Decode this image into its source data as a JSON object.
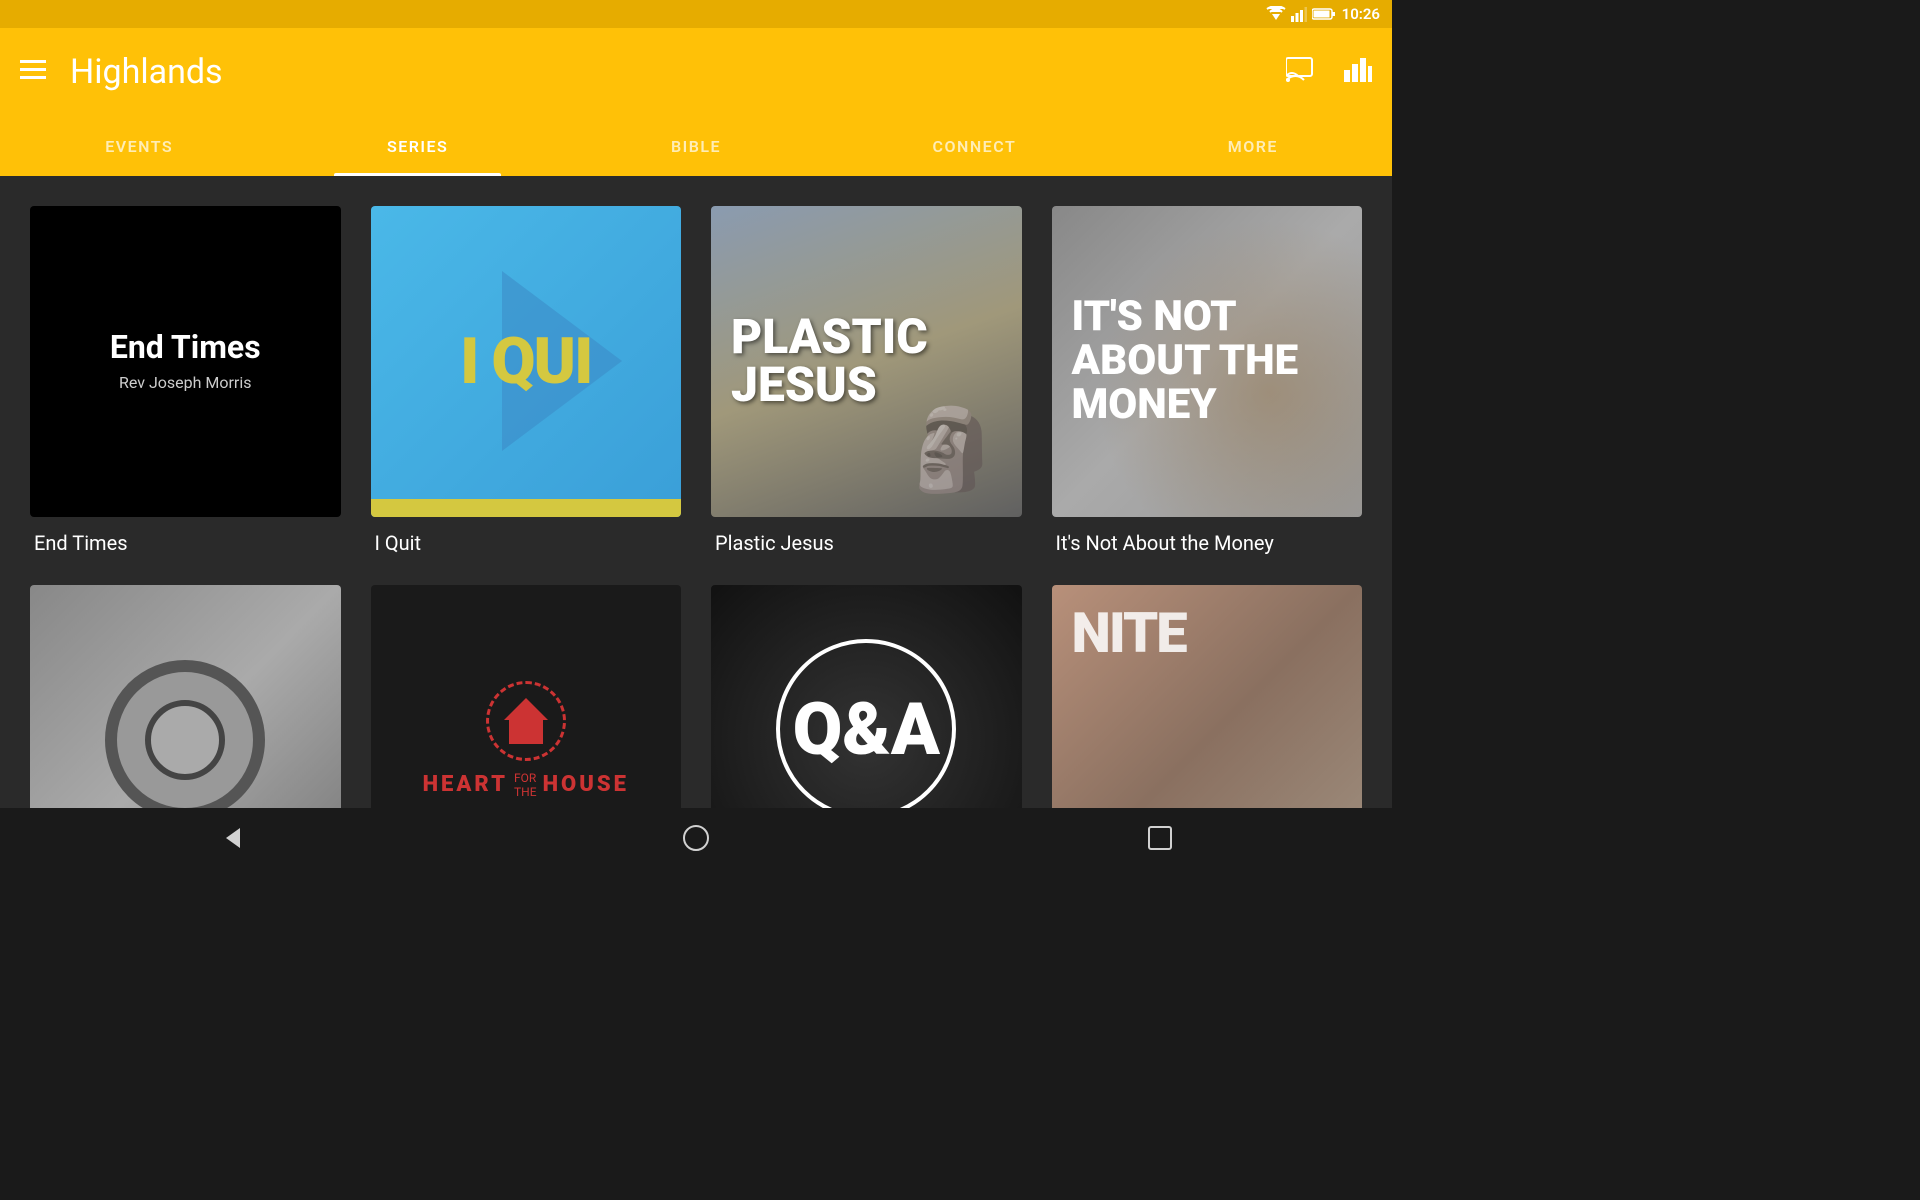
{
  "statusBar": {
    "time": "10:26"
  },
  "appBar": {
    "title": "Highlands",
    "menuIconLabel": "menu",
    "castIconLabel": "cast",
    "analyticsIconLabel": "analytics"
  },
  "tabs": [
    {
      "id": "events",
      "label": "EVENTS",
      "active": false
    },
    {
      "id": "series",
      "label": "SERIES",
      "active": true
    },
    {
      "id": "bible",
      "label": "BIBLE",
      "active": false
    },
    {
      "id": "connect",
      "label": "CONNECT",
      "active": false
    },
    {
      "id": "more",
      "label": "MORE",
      "active": false
    }
  ],
  "seriesGrid": {
    "row1": [
      {
        "id": "end-times",
        "title": "End Times",
        "subtitle": "Rev Joseph Morris",
        "thumbnailType": "end-times"
      },
      {
        "id": "i-quit",
        "title": "I Quit",
        "thumbnailType": "i-quit"
      },
      {
        "id": "plastic-jesus",
        "title": "Plastic Jesus",
        "thumbnailType": "plastic-jesus"
      },
      {
        "id": "not-about-money",
        "title": "It's Not About the Money",
        "thumbnailType": "not-about-money"
      }
    ],
    "row2": [
      {
        "id": "vault",
        "title": "",
        "thumbnailType": "vault"
      },
      {
        "id": "heart-house",
        "title": "",
        "thumbnailType": "heart-house"
      },
      {
        "id": "qa",
        "title": "",
        "thumbnailType": "qa"
      },
      {
        "id": "ignite",
        "title": "",
        "thumbnailType": "ignite"
      }
    ]
  },
  "navBar": {
    "backLabel": "back",
    "homeLabel": "home",
    "recentLabel": "recent"
  }
}
